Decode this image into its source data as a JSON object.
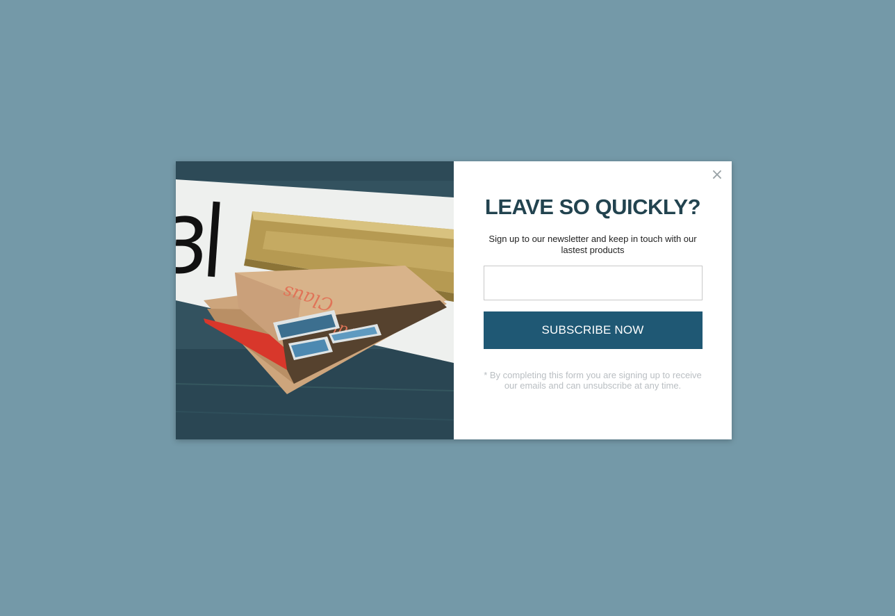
{
  "popup": {
    "close_icon": "close-icon",
    "close_glyph": "×",
    "title": "LEAVE SO QUICKLY?",
    "subtitle": "Sign up to our newsletter and keep in touch with our lastest products",
    "email": {
      "value": "",
      "placeholder": ""
    },
    "subscribe_label": "SUBSCRIBE NOW",
    "disclaimer": "* By completing this form you are signing up to receive our emails and can unsubscribe at any time.",
    "image": "mailbox-envelopes-photo"
  },
  "colors": {
    "backdrop": "#7499a8",
    "title": "#22434f",
    "button": "#1f5874",
    "disclaimer": "#b9bec2"
  }
}
